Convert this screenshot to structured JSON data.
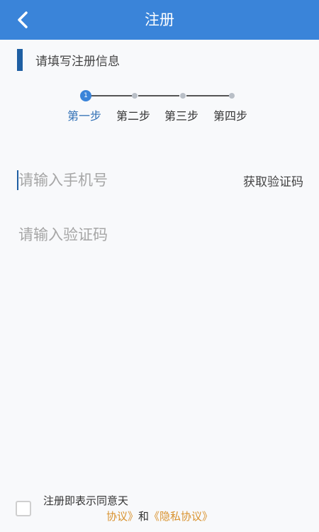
{
  "header": {
    "title": "注册",
    "back_icon": "chevron-left-icon"
  },
  "section": {
    "heading": "请填写注册信息"
  },
  "stepper": {
    "current_step": 1,
    "active_number": "1",
    "steps": [
      "第一步",
      "第二步",
      "第三步",
      "第四步"
    ]
  },
  "form": {
    "phone_placeholder": "请输入手机号",
    "phone_value": "",
    "get_code_label": "获取验证码",
    "code_placeholder": "请输入验证码",
    "code_value": ""
  },
  "agreement": {
    "checked": false,
    "line1": "注册即表示同意天",
    "line2_link1": "协议》",
    "line2_mid": "和",
    "line2_link2": "《隐私协议》"
  },
  "colors": {
    "header": "#3a84d9",
    "accent": "#2f6fb5",
    "link": "#d9922e"
  }
}
